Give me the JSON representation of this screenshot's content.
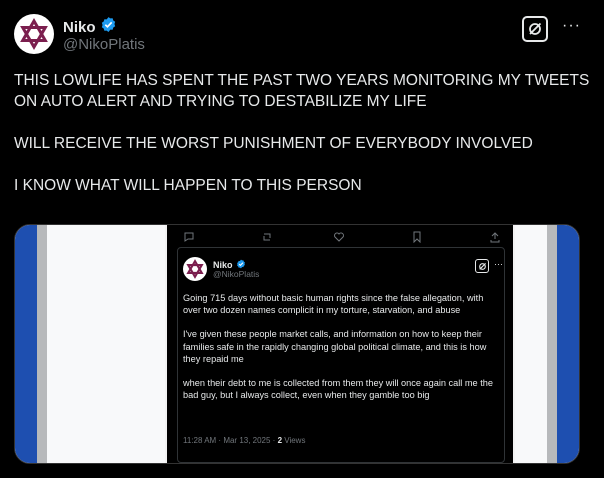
{
  "author": {
    "name": "Niko",
    "handle": "@NikoPlatis",
    "verified": true,
    "verified_color": "#1d9bf0"
  },
  "header": {
    "grok_icon": "grok-icon",
    "more_label": "···"
  },
  "tweet": {
    "paragraphs": [
      "THIS LOWLIFE HAS SPENT THE PAST TWO YEARS MONITORING MY TWEETS ON AUTO ALERT AND TRYING TO DESTABILIZE MY LIFE",
      "WILL RECEIVE THE WORST PUNISHMENT OF EVERYBODY INVOLVED",
      "I KNOW WHAT WILL HAPPEN TO THIS PERSON"
    ]
  },
  "embedded": {
    "name": "Niko",
    "handle": "@NikoPlatis",
    "more_label": "···",
    "paragraphs": [
      "Going 715 days without basic human rights since the false allegation, with over two dozen names complicit in my torture, starvation, and abuse",
      "I've given these people market calls, and information on how to keep their families safe in the rapidly changing global political climate, and this is how they repaid me",
      "when their debt to me is collected from them they will once again call me the bad guy, but I always collect, even when they gamble too big"
    ],
    "timestamp": "11:28 AM · Mar 13, 2025 ·",
    "views_count": "2",
    "views_label": "Views"
  },
  "colors": {
    "background": "#000000",
    "text": "#e7e9ea",
    "secondary": "#71767b",
    "flag_blue": "#1e4fb0",
    "avatar_star": "#7b1e4e"
  }
}
